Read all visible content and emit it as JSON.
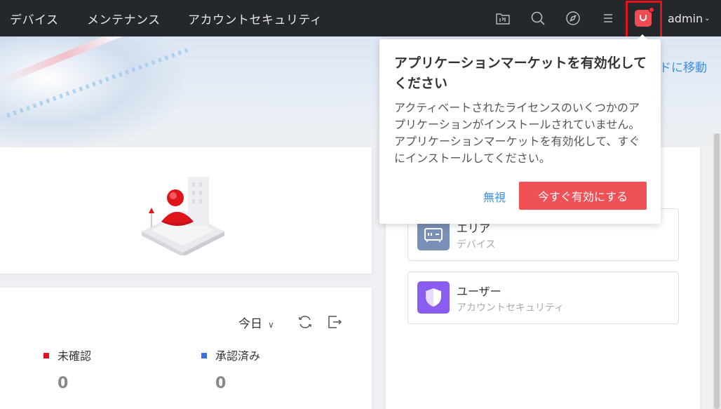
{
  "topnav": {
    "items": [
      {
        "label": "デバイス"
      },
      {
        "label": "メンテナンス"
      },
      {
        "label": "アカウントセキュリティ"
      }
    ],
    "icons": [
      "file-manager-icon",
      "search-icon",
      "compass-icon",
      "menu-icon",
      "app-market-icon"
    ],
    "user": "admin"
  },
  "banner": {
    "link_text": "ドに移動"
  },
  "stats": {
    "period": "今日",
    "legend": [
      {
        "label": "未確認",
        "color": "#e0151c",
        "value": "0"
      },
      {
        "label": "承認済み",
        "color": "#3f6fe0",
        "value": "0"
      }
    ]
  },
  "shortcuts": [
    {
      "title": "エリア",
      "subtitle": "デバイス",
      "icon": "device-area-icon",
      "color": "#7a8fb5"
    },
    {
      "title": "ユーザー",
      "subtitle": "アカウントセキュリティ",
      "icon": "shield-icon",
      "color": "#8a5cf0"
    }
  ],
  "popover": {
    "title": "アプリケーションマーケットを有効化してください",
    "body": "アクティベートされたライセンスのいくつかのアプリケーションがインストールされていません。アプリケーションマーケットを有効化して、すぐにインストールしてください。",
    "ignore_label": "無視",
    "enable_label": "今すぐ有効にする"
  },
  "colors": {
    "accent": "#f05157",
    "link": "#3a8ee6",
    "topbar": "#24272b"
  }
}
